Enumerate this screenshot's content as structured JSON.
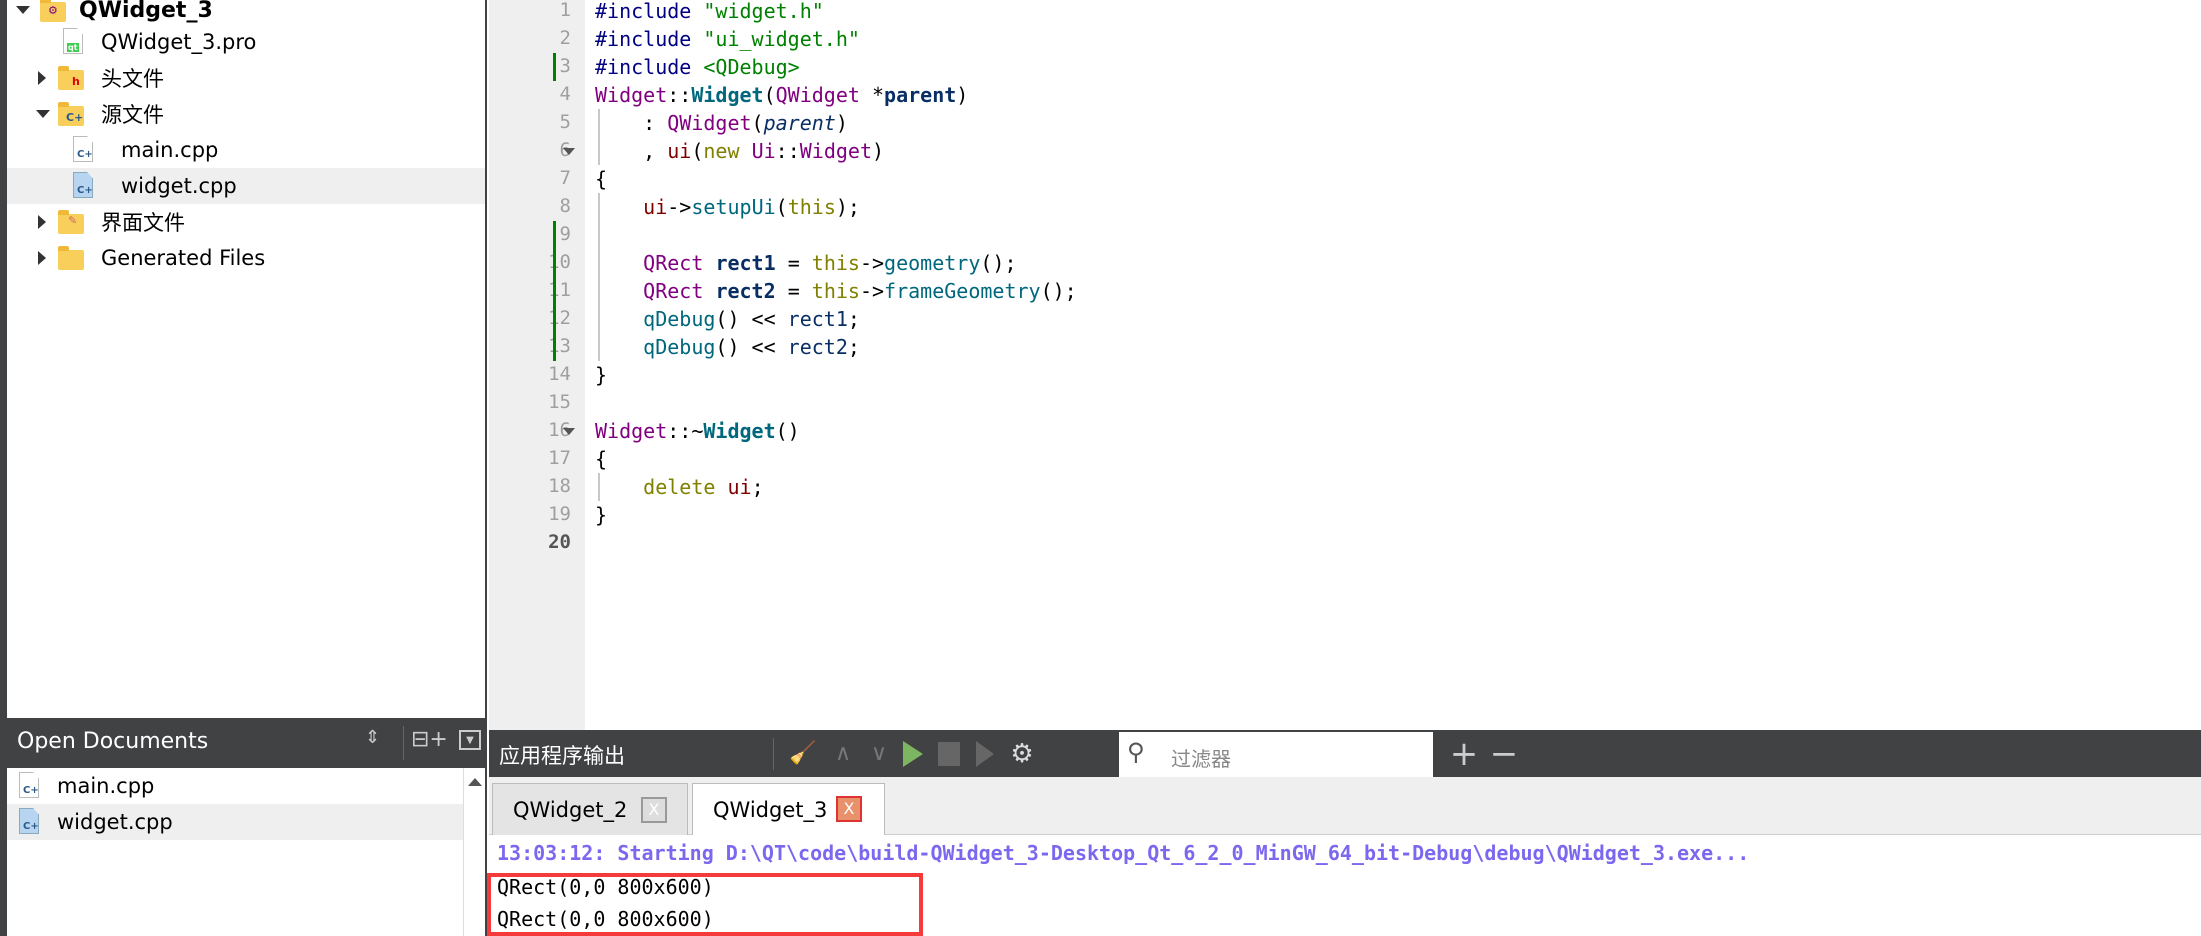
{
  "project_tree": {
    "project": "QWidget_3",
    "items": [
      {
        "label": "QWidget_3.pro",
        "icon": "qt-pro-file-icon"
      },
      {
        "label": "头文件",
        "icon": "header-folder-icon",
        "expanded": false
      },
      {
        "label": "源文件",
        "icon": "source-folder-icon",
        "expanded": true
      },
      {
        "label": "main.cpp",
        "icon": "cpp-file-icon"
      },
      {
        "label": "widget.cpp",
        "icon": "cpp-file-icon",
        "selected": true
      },
      {
        "label": "界面文件",
        "icon": "forms-folder-icon",
        "expanded": false
      },
      {
        "label": "Generated Files",
        "icon": "folder-icon",
        "expanded": false
      }
    ]
  },
  "open_documents": {
    "title": "Open Documents",
    "items": [
      {
        "label": "main.cpp"
      },
      {
        "label": "widget.cpp",
        "selected": true
      }
    ]
  },
  "editor": {
    "line_numbers": [
      "1",
      "2",
      "3",
      "4",
      "5",
      "6",
      "7",
      "8",
      "9",
      "10",
      "11",
      "12",
      "13",
      "14",
      "15",
      "16",
      "17",
      "18",
      "19",
      "20"
    ],
    "lines": [
      [
        [
          "#include ",
          "pp"
        ],
        [
          "\"widget.h\"",
          "str"
        ]
      ],
      [
        [
          "#include ",
          "pp"
        ],
        [
          "\"ui_widget.h\"",
          "str"
        ]
      ],
      [
        [
          "#include ",
          "pp"
        ],
        [
          "<QDebug>",
          "str"
        ]
      ],
      [
        [
          "Widget",
          "ty"
        ],
        [
          "::",
          ""
        ],
        [
          "Widget",
          "fn"
        ],
        [
          "(",
          ""
        ],
        [
          "QWidget",
          "ty"
        ],
        [
          " *",
          ""
        ],
        [
          "parent",
          "par"
        ],
        [
          ")",
          ""
        ]
      ],
      [
        [
          "    : ",
          ""
        ],
        [
          "QWidget",
          "ty"
        ],
        [
          "(",
          ""
        ],
        [
          "parent",
          "pit"
        ],
        [
          ")",
          ""
        ]
      ],
      [
        [
          "    , ",
          ""
        ],
        [
          "ui",
          "mem"
        ],
        [
          "(",
          ""
        ],
        [
          "new",
          "kw"
        ],
        [
          " ",
          ""
        ],
        [
          "Ui",
          "ty"
        ],
        [
          "::",
          ""
        ],
        [
          "Widget",
          "ty"
        ],
        [
          ")",
          ""
        ]
      ],
      [
        [
          "{",
          ""
        ]
      ],
      [
        [
          "    ",
          ""
        ],
        [
          "ui",
          "mem"
        ],
        [
          "->",
          ""
        ],
        [
          "setupUi",
          "call"
        ],
        [
          "(",
          ""
        ],
        [
          "this",
          "kw"
        ],
        [
          ");",
          ""
        ]
      ],
      [],
      [
        [
          "    ",
          ""
        ],
        [
          "QRect",
          "ty"
        ],
        [
          " ",
          ""
        ],
        [
          "rect1",
          "var"
        ],
        [
          " = ",
          ""
        ],
        [
          "this",
          "kw"
        ],
        [
          "->",
          ""
        ],
        [
          "geometry",
          "call"
        ],
        [
          "();",
          ""
        ]
      ],
      [
        [
          "    ",
          ""
        ],
        [
          "QRect",
          "ty"
        ],
        [
          " ",
          ""
        ],
        [
          "rect2",
          "var"
        ],
        [
          " = ",
          ""
        ],
        [
          "this",
          "kw"
        ],
        [
          "->",
          ""
        ],
        [
          "frameGeometry",
          "call"
        ],
        [
          "();",
          ""
        ]
      ],
      [
        [
          "    ",
          ""
        ],
        [
          "qDebug",
          "call"
        ],
        [
          "() << ",
          ""
        ],
        [
          "rect1",
          "lv"
        ],
        [
          ";",
          ""
        ]
      ],
      [
        [
          "    ",
          ""
        ],
        [
          "qDebug",
          "call"
        ],
        [
          "() << ",
          ""
        ],
        [
          "rect2",
          "lv"
        ],
        [
          ";",
          ""
        ]
      ],
      [
        [
          "}",
          ""
        ]
      ],
      [],
      [
        [
          "Widget",
          "ty"
        ],
        [
          "::~",
          ""
        ],
        [
          "Widget",
          "fn"
        ],
        [
          "()",
          ""
        ]
      ],
      [
        [
          "{",
          ""
        ]
      ],
      [
        [
          "    ",
          ""
        ],
        [
          "delete",
          "kw"
        ],
        [
          " ",
          ""
        ],
        [
          "ui",
          "mem"
        ],
        [
          ";",
          ""
        ]
      ],
      [
        [
          "}",
          ""
        ]
      ],
      []
    ]
  },
  "output": {
    "title": "应用程序输出",
    "filter_placeholder": "过滤器",
    "tabs": [
      {
        "label": "QWidget_2",
        "active": false
      },
      {
        "label": "QWidget_3",
        "active": true
      }
    ],
    "close_glyph": "X",
    "lines": [
      "13:03:12: Starting D:\\QT\\code\\build-QWidget_3-Desktop_Qt_6_2_0_MinGW_64_bit-Debug\\debug\\QWidget_3.exe...",
      "QRect(0,0 800x600)",
      "QRect(0,0 800x600)"
    ],
    "start_color": "#7b68ee",
    "highlight_color": "#f43a3a"
  }
}
